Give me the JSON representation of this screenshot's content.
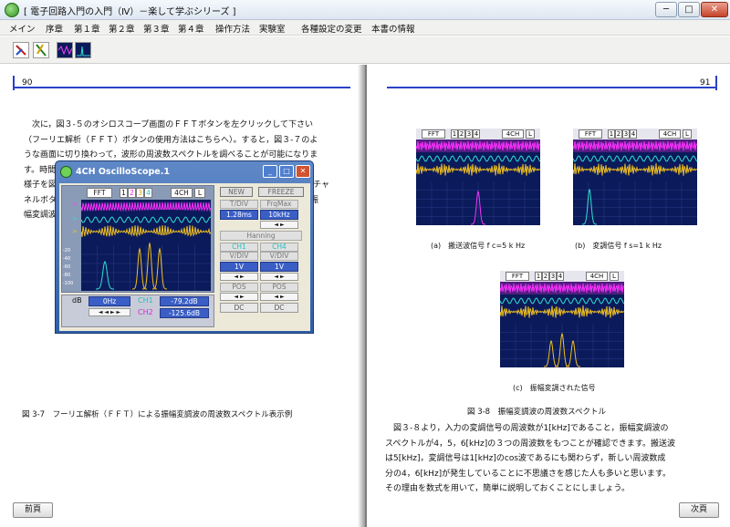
{
  "window": {
    "title": "[ 電子回路入門の入門（Ⅳ）－楽して学ぶシリーズ ]",
    "min": "─",
    "max": "□",
    "close": "✕"
  },
  "menu": [
    "メイン",
    "序章",
    "第１章",
    "第２章",
    "第３章",
    "第４章",
    "操作方法",
    "実験室",
    "各種設定の変更",
    "本書の情報"
  ],
  "toolbar": {
    "icons": [
      "pen-tool-icon",
      "cursor-tool-icon",
      "scope-4ch-icon",
      "scope-fa-icon"
    ],
    "tool3_label": "4CH",
    "tool4_label": "F.A"
  },
  "left": {
    "page_number": "90",
    "paragraph": "　次に，図３-５のオシロスコープ画面のＦＦＴボタンを左クリックして下さい\n（フーリエ解析（ＦＦＴ）ボタンの使用方法はこちらへ）。すると，図３-７のよ\nうな画面に切り換わって，波形の周波数スペクトルを調べることが可能になりま\nす。時間波形を調べたのと同様に，変調度ｍ＝0.5のときの周波数スペクトルの\n様子を図３-８に示します。なお，ＦＦＴボタンの右に表示されている１～４のチャ\nネルボタンを左クリックして，画面上には入力信号（変調信号）と出力信号（振\n幅変調波）の周波数スペクトルを表示するように設定してあります。",
    "link_text": "こちらへ",
    "figure_caption": "図 3-7　フーリエ解析（ＦＦＴ）による振幅変調波の周波数スペクトル表示例",
    "prev_button": "前頁"
  },
  "scope": {
    "title": "4CH OscilloScope.1",
    "fft": "FFT",
    "ch_buttons": [
      "1",
      "2",
      "3",
      "4"
    ],
    "mode": "4CH",
    "l": "L",
    "new": "NEW",
    "freeze": "FREEZE",
    "tdiv_label": "T/DIV",
    "tdiv_value": "1.28ms",
    "frqmax_label": "FrqMax",
    "frqmax_value": "10kHz",
    "window_func": "Hanning",
    "ch1": "CH1",
    "ch4": "CH4",
    "vdiv_label": "V/DIV",
    "vdiv1": "1V",
    "vdiv4": "1V",
    "pos_label": "POS",
    "pos1": "DC",
    "pos4": "DC",
    "db_label": "dB",
    "freq_readout": "0Hz",
    "ch1_label": "CH1",
    "ch2_label": "CH2",
    "ch1_db": "-79.2dB",
    "ch2_db": "-125.6dB",
    "y_ticks": [
      "-20",
      "-40",
      "-60",
      "-80",
      "-100"
    ]
  },
  "right": {
    "page_number": "91",
    "fig_a_caption": "(a)　搬送波信号 f c=5 k Hz",
    "fig_b_caption": "(b)　変調信号 f s=1 k Hz",
    "fig_c_caption": "(c)　振幅変調された信号",
    "figure_title": "図 3-8　振幅変調波の周波数スペクトル",
    "paragraph": "　図３-８より，入力の変調信号の周波数が1[kHz]であること，振幅変調波の\nスペクトルが4，5，6[kHz]の３つの周波数をもつことが確認できます。搬送波\nは5[kHz]，変調信号は1[kHz]のcos波であるにも関わらず，新しい周波数成\n分の4，6[kHz]が発生していることに不思議さを感じた人も多いと思います。\nその理由を数式を用いて，簡単に説明しておくことにしましょう。",
    "next_button": "次頁"
  },
  "colors": {
    "accent": "#2a42c8",
    "screen": "#0b1a5a",
    "ch1": "#ff30ff",
    "ch2": "#30e0d0",
    "ch3": "#f0c020"
  }
}
